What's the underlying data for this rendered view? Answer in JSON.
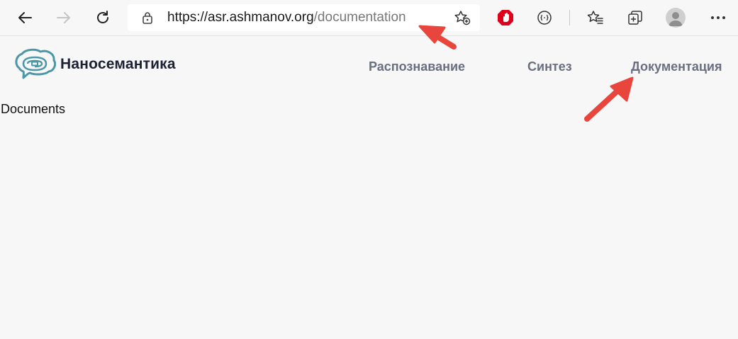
{
  "browser": {
    "url_domain": "https://asr.ashmanov.org",
    "url_path": "/documentation",
    "accent_block": "#e0001b",
    "icons": [
      "back-icon",
      "forward-icon",
      "refresh-icon",
      "lock-icon",
      "add-favorite-icon",
      "adblock-icon",
      "extension-icon",
      "favorites-icon",
      "collections-icon",
      "profile-avatar"
    ]
  },
  "site": {
    "brand": "Наносемантика",
    "nav": [
      {
        "label": "Распознавание"
      },
      {
        "label": "Синтез"
      },
      {
        "label": "Документация"
      }
    ],
    "brand_color": "#4a97a8"
  },
  "main": {
    "heading": "Documents"
  },
  "annotations": {
    "arrow_color": "#e8453c"
  }
}
